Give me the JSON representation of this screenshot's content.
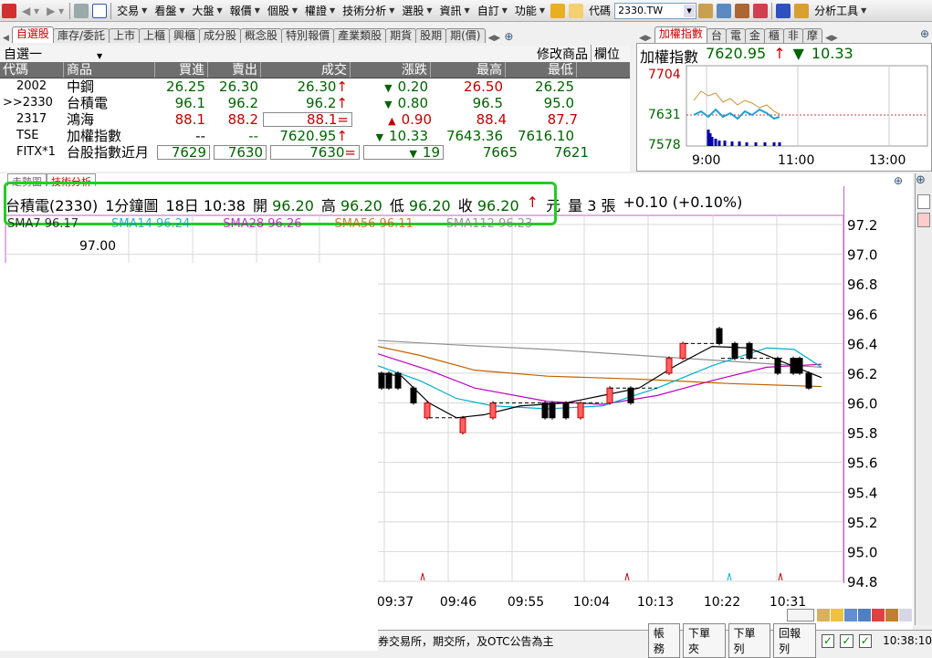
{
  "toolbar": {
    "items": [
      "交易",
      "看盤",
      "大盤",
      "報價",
      "個股",
      "權證",
      "技術分析",
      "選股",
      "資訊",
      "自訂",
      "功能"
    ],
    "code_label": "代碼",
    "code_value": "2330.TW",
    "analysis_tools": "分析工具"
  },
  "watchlist": {
    "tabs": [
      "自選股",
      "庫存/委託",
      "上市",
      "上櫃",
      "興櫃",
      "成分股",
      "概念股",
      "特別報價",
      "產業類股",
      "期貨",
      "股期",
      "期(價)"
    ],
    "list_name": "自選一",
    "modify_label": "修改商品",
    "column_label": "欄位",
    "columns": [
      "代碼",
      "商品",
      "買進",
      "賣出",
      "成交",
      "漲跌",
      "最高",
      "最低"
    ],
    "rows": [
      {
        "code": "2002",
        "name": "中鋼",
        "bid": "26.25",
        "ask": "26.30",
        "last": "26.30",
        "chg": "0.20",
        "high": "26.50",
        "low": "26.25",
        "last_arrow": "↑",
        "chg_arrow": "▼"
      },
      {
        "code": ">>2330",
        "name": "台積電",
        "bid": "96.1",
        "ask": "96.2",
        "last": "96.2",
        "chg": "0.80",
        "high": "96.5",
        "low": "95.0",
        "last_arrow": "↑",
        "chg_arrow": "▼"
      },
      {
        "code": "2317",
        "name": "鴻海",
        "bid": "88.1",
        "ask": "88.2",
        "last": "88.1",
        "chg": "0.90",
        "high": "88.4",
        "low": "87.7",
        "last_arrow": "=",
        "chg_arrow": "▲"
      },
      {
        "code": "TSE",
        "name": "加權指數",
        "bid": "--",
        "ask": "--",
        "last": "7620.95",
        "chg": "10.33",
        "high": "7643.36",
        "low": "7616.10",
        "last_arrow": "↑",
        "chg_arrow": "▼"
      },
      {
        "code": "FITX*1",
        "name": "台股指數近月",
        "bid": "7629",
        "ask": "7630",
        "last": "7630",
        "chg": "19",
        "high": "7665",
        "low": "7621",
        "last_arrow": "=",
        "chg_arrow": "▼"
      }
    ]
  },
  "index_panel": {
    "tabs": [
      "加權指數",
      "台",
      "電",
      "金",
      "櫃",
      "非",
      "摩"
    ],
    "title": "加權指數",
    "value": "7620.95",
    "change": "10.33",
    "y_labels": [
      "7704",
      "7631",
      "7578"
    ],
    "x_labels": [
      "9:00",
      "11:00",
      "13:00"
    ]
  },
  "chart": {
    "tabs": [
      "走勢圖",
      "技術分析"
    ],
    "header": {
      "stock": "台積電(2330)",
      "period": "1分鐘圖",
      "date": "18日 10:38",
      "open_label": "開",
      "open": "96.20",
      "high_label": "高",
      "high": "96.20",
      "low_label": "低",
      "low": "96.20",
      "close_label": "收",
      "close": "96.20",
      "unit": "元",
      "vol_label": "量",
      "vol": "3",
      "vol_unit": "張",
      "change": "+0.10 (+0.10%)"
    },
    "ma_legend": [
      {
        "label": "SMA7 96.17",
        "color": "#000000"
      },
      {
        "label": "SMA14 96.24",
        "color": "#00a0c0"
      },
      {
        "label": "SMA28 96.26",
        "color": "#c000c0"
      },
      {
        "label": "SMA56 96.11",
        "color": "#c06000"
      },
      {
        "label": "SMA112 96.23",
        "color": "#808080"
      }
    ],
    "cursor_value": "97.00"
  },
  "chart_data": {
    "type": "candlestick",
    "ylim": [
      94.8,
      97.2
    ],
    "y_ticks": [
      "97.2",
      "97.0",
      "96.8",
      "96.6",
      "96.4",
      "96.2",
      "96.0",
      "95.8",
      "95.6",
      "95.4",
      "95.2",
      "95.0",
      "94.8"
    ],
    "x_ticks": [
      "09:37",
      "09:46",
      "09:55",
      "10:04",
      "10:13",
      "10:22",
      "10:31"
    ]
  },
  "status": {
    "text": "券交易所，期交所，及OTC公告為主",
    "buttons": [
      "帳務",
      "下單夾",
      "下單列",
      "回報列"
    ],
    "time": "10:38:10"
  }
}
